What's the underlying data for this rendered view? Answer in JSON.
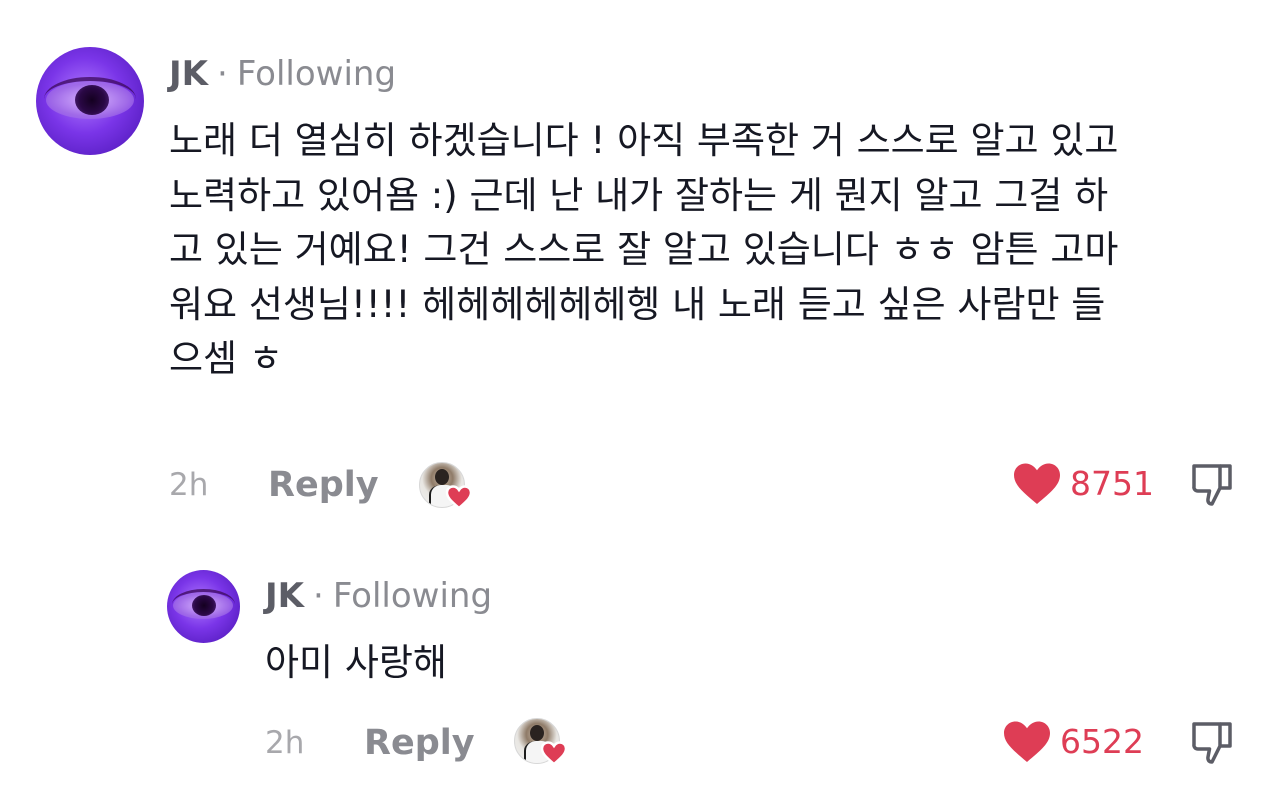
{
  "comments": [
    {
      "author": "JK",
      "separator": "·",
      "follow_status": "Following",
      "text_lines": [
        "노래 더 열심히 하겠습니다 ! 아직 부족한 거 스스로 알고 있고",
        "노력하고 있어욤 :) 근데 난 내가 잘하는 게 뭔지 알고 그걸 하",
        "고 있는 거예요! 그건 스스로 잘 알고 있습니다 ㅎㅎ 암튼 고마",
        "워요 선생님!!!! 헤헤헤헤헤헤헹 내 노래 듣고 싶은 사람만 들",
        "으셈 ㅎ"
      ],
      "time": "2h",
      "reply_label": "Reply",
      "like_count": "8751",
      "liked_by_creator": true
    },
    {
      "author": "JK",
      "separator": "·",
      "follow_status": "Following",
      "text_lines": [
        "아미 사랑해"
      ],
      "time": "2h",
      "reply_label": "Reply",
      "like_count": "6522",
      "liked_by_creator": true
    }
  ],
  "icons": {
    "like": "heart-icon",
    "dislike": "thumbs-down-icon",
    "creator_like_badge": "creator-heart-badge-icon"
  },
  "colors": {
    "like_red": "#de3d55",
    "text_primary": "#161823",
    "text_secondary": "#8a8b91",
    "time_gray": "#a8a8ac"
  }
}
